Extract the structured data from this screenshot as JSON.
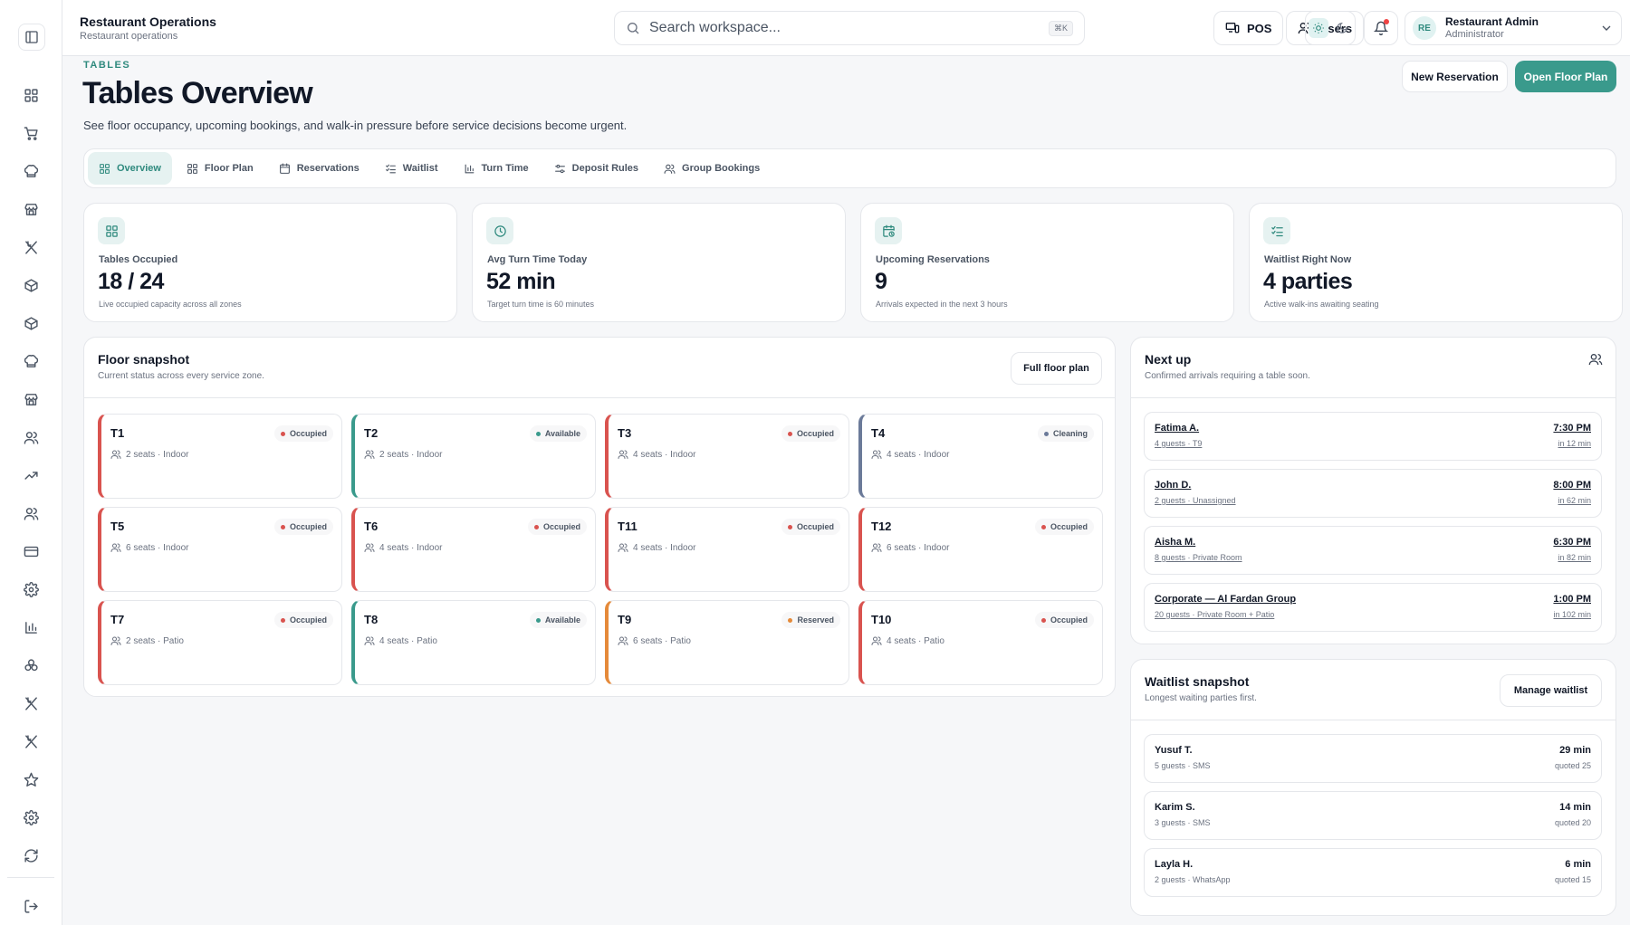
{
  "header": {
    "title": "Restaurant Operations",
    "subtitle": "Restaurant operations",
    "search_placeholder": "Search workspace...",
    "search_shortcut": "⌘K",
    "pos_label": "POS",
    "users_label": "Users",
    "user_initials": "RE",
    "user_name": "Restaurant Admin",
    "user_role": "Administrator"
  },
  "page": {
    "eyebrow": "TABLES",
    "title": "Tables Overview",
    "description": "See floor occupancy, upcoming bookings, and walk-in pressure before service decisions become urgent.",
    "new_reservation_label": "New Reservation",
    "open_floor_plan_label": "Open Floor Plan"
  },
  "tabs": [
    {
      "label": "Overview",
      "icon": "grid-icon"
    },
    {
      "label": "Floor Plan",
      "icon": "grid-icon"
    },
    {
      "label": "Reservations",
      "icon": "calendar-icon"
    },
    {
      "label": "Waitlist",
      "icon": "list-check-icon"
    },
    {
      "label": "Turn Time",
      "icon": "bar-chart-icon"
    },
    {
      "label": "Deposit Rules",
      "icon": "sliders-icon"
    },
    {
      "label": "Group Bookings",
      "icon": "users-icon"
    }
  ],
  "kpis": [
    {
      "label": "Tables Occupied",
      "value": "18 / 24",
      "hint": "Live occupied capacity across all zones",
      "icon": "grid-icon"
    },
    {
      "label": "Avg Turn Time Today",
      "value": "52 min",
      "hint": "Target turn time is 60 minutes",
      "icon": "clock-icon"
    },
    {
      "label": "Upcoming Reservations",
      "value": "9",
      "hint": "Arrivals expected in the next 3 hours",
      "icon": "calendar-clock-icon"
    },
    {
      "label": "Waitlist Right Now",
      "value": "4 parties",
      "hint": "Active walk-ins awaiting seating",
      "icon": "list-check-icon"
    }
  ],
  "floor": {
    "title": "Floor snapshot",
    "subtitle": "Current status across every service zone.",
    "button_label": "Full floor plan",
    "tables": [
      {
        "name": "T1",
        "meta": "2 seats · Indoor",
        "status": "Occupied",
        "color": "#d9534f"
      },
      {
        "name": "T2",
        "meta": "2 seats · Indoor",
        "status": "Available",
        "color": "#3a9a8c"
      },
      {
        "name": "T3",
        "meta": "4 seats · Indoor",
        "status": "Occupied",
        "color": "#d9534f"
      },
      {
        "name": "T4",
        "meta": "4 seats · Indoor",
        "status": "Cleaning",
        "color": "#6b7a99"
      },
      {
        "name": "T5",
        "meta": "6 seats · Indoor",
        "status": "Occupied",
        "color": "#d9534f"
      },
      {
        "name": "T6",
        "meta": "4 seats · Indoor",
        "status": "Occupied",
        "color": "#d9534f"
      },
      {
        "name": "T11",
        "meta": "4 seats · Indoor",
        "status": "Occupied",
        "color": "#d9534f"
      },
      {
        "name": "T12",
        "meta": "6 seats · Indoor",
        "status": "Occupied",
        "color": "#d9534f"
      },
      {
        "name": "T7",
        "meta": "2 seats · Patio",
        "status": "Occupied",
        "color": "#d9534f"
      },
      {
        "name": "T8",
        "meta": "4 seats · Patio",
        "status": "Available",
        "color": "#3a9a8c"
      },
      {
        "name": "T9",
        "meta": "6 seats · Patio",
        "status": "Reserved",
        "color": "#e58a3a"
      },
      {
        "name": "T10",
        "meta": "4 seats · Patio",
        "status": "Occupied",
        "color": "#d9534f"
      }
    ]
  },
  "next_up": {
    "title": "Next up",
    "subtitle": "Confirmed arrivals requiring a table soon.",
    "items": [
      {
        "name": "Fatima A.",
        "detail": "4 guests · T9",
        "time": "7:30 PM",
        "eta": "in 12 min"
      },
      {
        "name": "John D.",
        "detail": "2 guests · Unassigned",
        "time": "8:00 PM",
        "eta": "in 62 min"
      },
      {
        "name": "Aisha M.",
        "detail": "8 guests · Private Room",
        "time": "6:30 PM",
        "eta": "in 82 min"
      },
      {
        "name": "Corporate — Al Fardan Group",
        "detail": "20 guests · Private Room + Patio",
        "time": "1:00 PM",
        "eta": "in 102 min"
      }
    ]
  },
  "waitlist": {
    "title": "Waitlist snapshot",
    "subtitle": "Longest waiting parties first.",
    "button_label": "Manage waitlist",
    "items": [
      {
        "name": "Yusuf T.",
        "detail": "5 guests · SMS",
        "wait": "29 min",
        "quoted": "quoted 25"
      },
      {
        "name": "Karim S.",
        "detail": "3 guests · SMS",
        "wait": "14 min",
        "quoted": "quoted 20"
      },
      {
        "name": "Layla H.",
        "detail": "2 guests · WhatsApp",
        "wait": "6 min",
        "quoted": "quoted 15"
      }
    ]
  },
  "sidebar": {
    "items": [
      "grid-icon",
      "cart-icon",
      "chef-hat-icon",
      "store-icon",
      "utensils-icon",
      "box-icon",
      "box-icon",
      "chef-hat-icon",
      "store-icon",
      "users-icon",
      "trending-up-icon",
      "users-icon",
      "credit-card-icon",
      "gear-icon",
      "bar-chart-icon",
      "layers-icon",
      "utensils-icon",
      "utensils-icon",
      "star-icon",
      "gear-icon",
      "refresh-icon"
    ]
  },
  "colors": {
    "accent": "#3a9a8c",
    "occupied": "#d9534f",
    "available": "#3a9a8c",
    "reserved": "#e58a3a",
    "cleaning": "#6b7a99"
  }
}
